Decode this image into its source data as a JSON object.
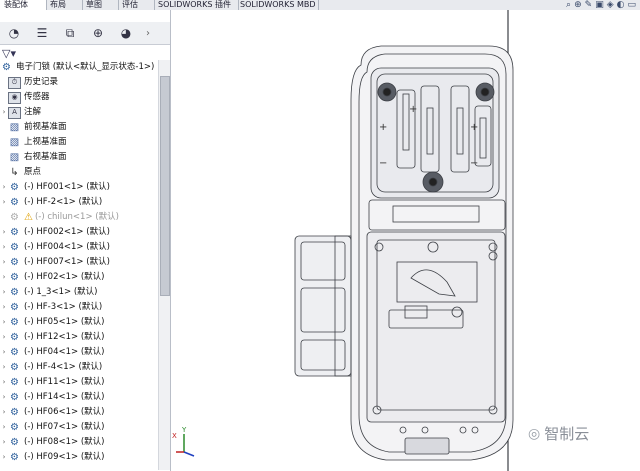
{
  "tabs": [
    "装配体",
    "布局",
    "草图",
    "评估",
    "SOLIDWORKS 插件",
    "SOLIDWORKS MBD"
  ],
  "top_icons": [
    "search-icon",
    "zoom-icon",
    "view-icon",
    "display-icon",
    "appearance-icon",
    "scene-icon",
    "monitor-icon"
  ],
  "panel_tabs": [
    "feature-manager-icon",
    "property-manager-icon",
    "configuration-manager-icon",
    "dimxpert-icon",
    "display-manager-icon"
  ],
  "tree": {
    "root": "电子门锁  (默认<默认_显示状态-1>)",
    "items": [
      {
        "label": "历史记录",
        "icon": "folder-icon"
      },
      {
        "label": "传感器",
        "icon": "sensor-icon"
      },
      {
        "label": "注解",
        "icon": "annotation-icon"
      },
      {
        "label": "前视基准面",
        "icon": "plane-icon"
      },
      {
        "label": "上视基准面",
        "icon": "plane-icon"
      },
      {
        "label": "右视基准面",
        "icon": "plane-icon"
      },
      {
        "label": "原点",
        "icon": "origin-icon"
      },
      {
        "label": "(-) HF001<1> (默认)",
        "icon": "part-icon"
      },
      {
        "label": "(-) HF-2<1> (默认)",
        "icon": "part-icon"
      },
      {
        "label": "(-) chilun<1> (默认)",
        "icon": "part-icon"
      },
      {
        "label": "(-) HF002<1> (默认)",
        "icon": "part-icon"
      },
      {
        "label": "(-) HF004<1> (默认)",
        "icon": "part-icon"
      },
      {
        "label": "(-) HF007<1> (默认)",
        "icon": "part-icon"
      },
      {
        "label": "(-) HF02<1> (默认)",
        "icon": "part-icon"
      },
      {
        "label": "(-) 1_3<1> (默认)",
        "icon": "part-icon"
      },
      {
        "label": "(-) HF-3<1> (默认)",
        "icon": "part-icon"
      },
      {
        "label": "(-) HF05<1> (默认)",
        "icon": "part-icon"
      },
      {
        "label": "(-) HF12<1> (默认)",
        "icon": "part-icon"
      },
      {
        "label": "(-) HF04<1> (默认)",
        "icon": "part-icon"
      },
      {
        "label": "(-) HF-4<1> (默认)",
        "icon": "part-icon"
      },
      {
        "label": "(-) HF11<1> (默认)",
        "icon": "part-icon"
      },
      {
        "label": "(-) HF14<1> (默认)",
        "icon": "part-icon"
      },
      {
        "label": "(-) HF06<1> (默认)",
        "icon": "part-icon"
      },
      {
        "label": "(-) HF07<1> (默认)",
        "icon": "part-icon"
      },
      {
        "label": "(-) HF08<1> (默认)",
        "icon": "part-icon"
      },
      {
        "label": "(-) HF09<1> (默认)",
        "icon": "part-icon"
      }
    ]
  },
  "watermark": "智制云",
  "triad": {
    "x": "X",
    "y": "Y"
  },
  "colors": {
    "line": "#3c3f45",
    "body": "#f3f3f5",
    "warning": "#e0a000"
  }
}
